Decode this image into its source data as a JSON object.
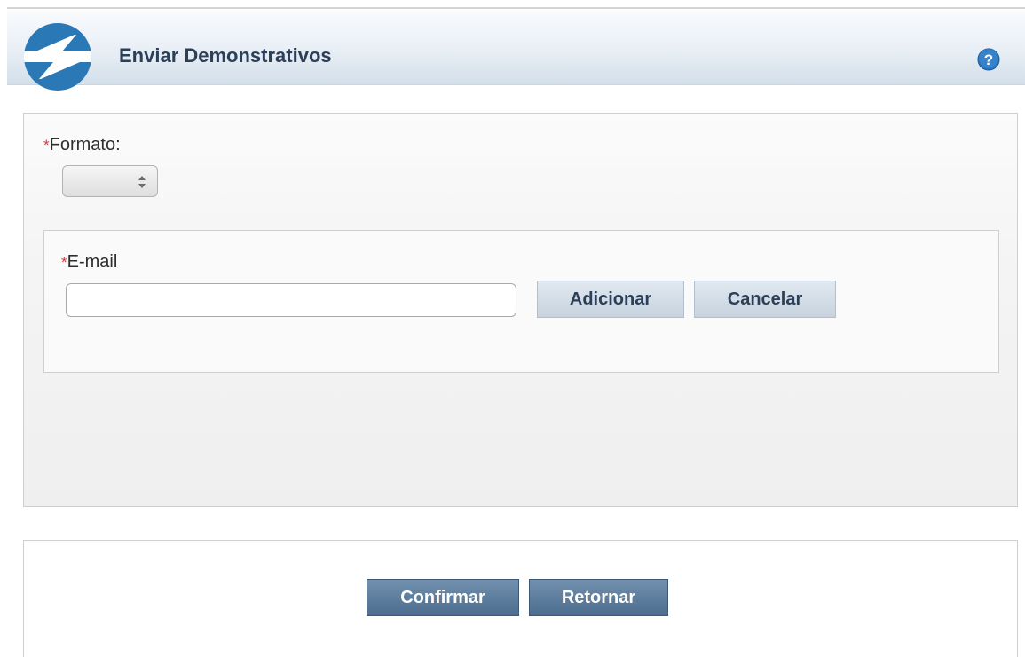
{
  "header": {
    "title": "Enviar Demonstrativos",
    "logo_icon": "serpro-s-logo-icon",
    "help_icon": "question-help-icon",
    "accent_color": "#2a78b6"
  },
  "form": {
    "formato": {
      "required_mark": "*",
      "label": "Formato:",
      "selected_value": ""
    },
    "email_section": {
      "required_mark": "*",
      "label": "E-mail",
      "input_value": "",
      "add_button": "Adicionar",
      "cancel_button": "Cancelar"
    }
  },
  "actions": {
    "confirm_button": "Confirmar",
    "return_button": "Retornar"
  }
}
